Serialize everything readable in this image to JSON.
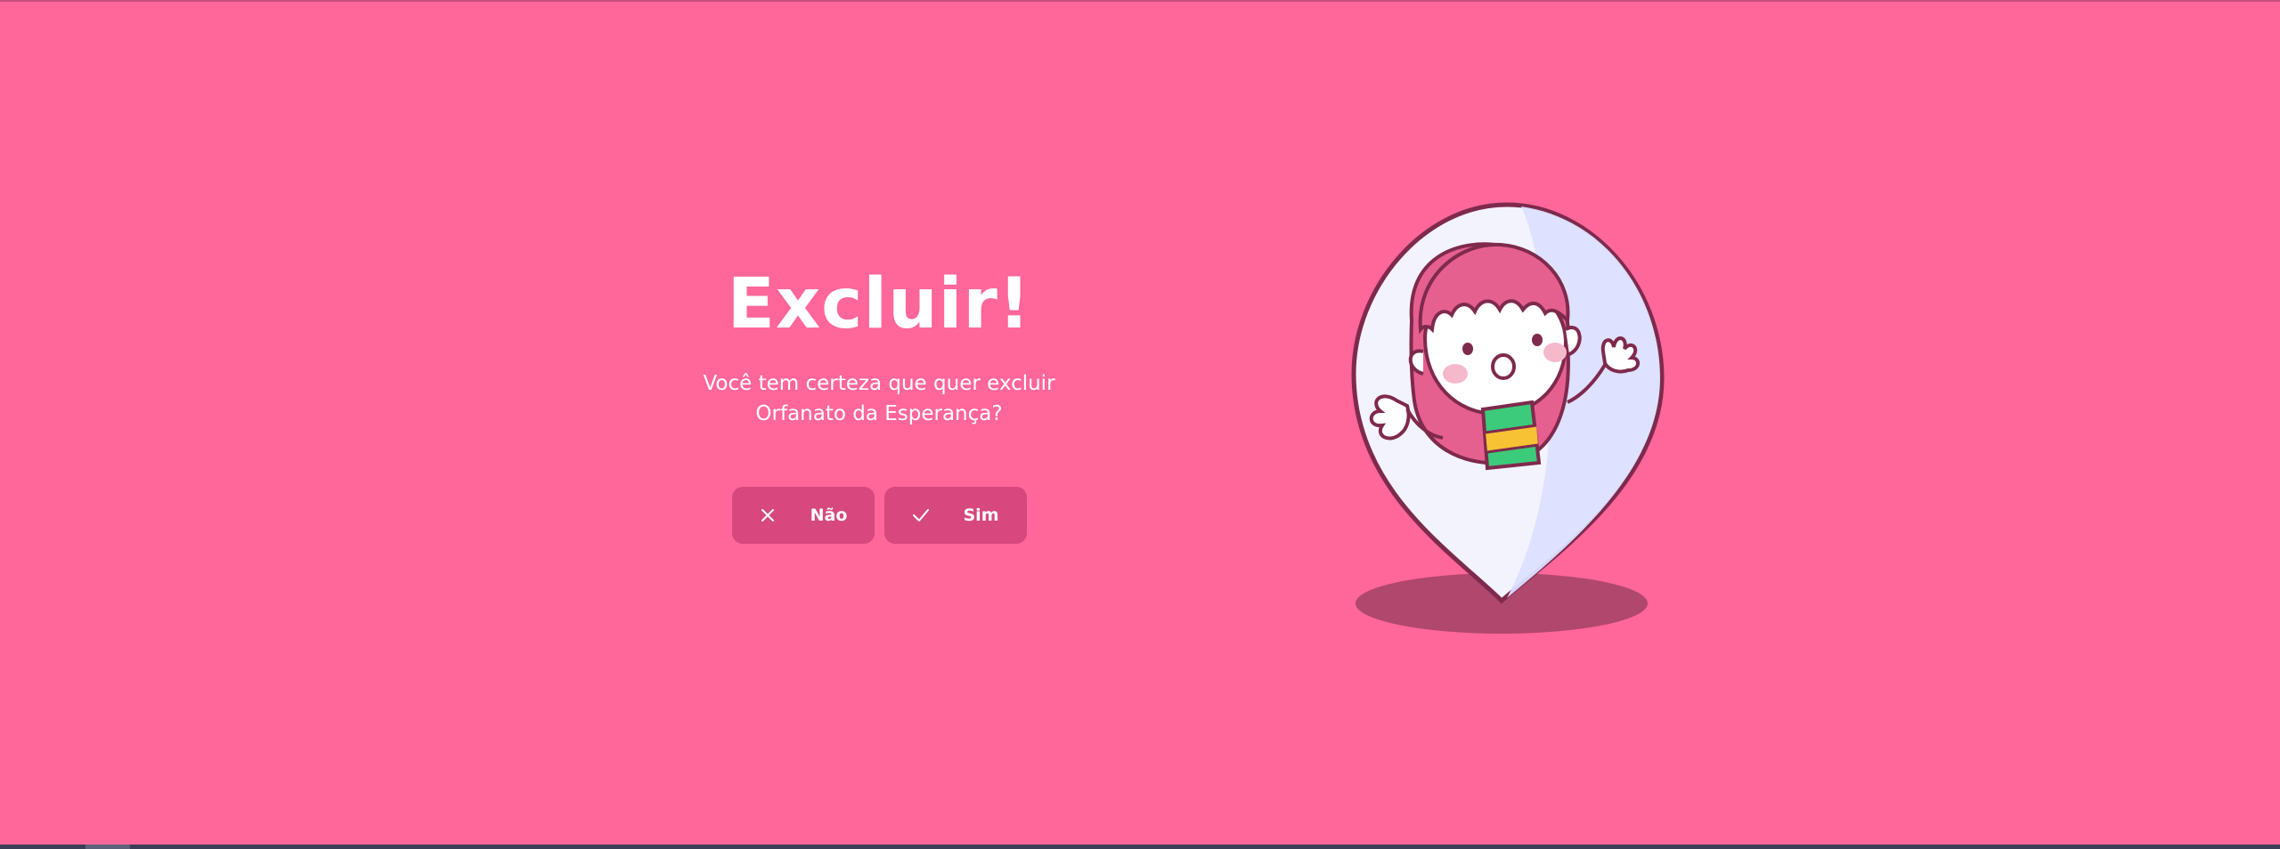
{
  "dialog": {
    "title": "Excluir!",
    "message_line1": "Você tem certeza que quer excluir",
    "message_line2": "Orfanato da Esperança?"
  },
  "buttons": {
    "no_label": "Não",
    "no_icon": "close-icon",
    "yes_label": "Sim",
    "yes_icon": "check-icon"
  },
  "illustration": {
    "name": "map-pin-with-child"
  },
  "colors": {
    "background": "#FF669A",
    "button": "#D6487E",
    "text": "#FFFFFF"
  }
}
